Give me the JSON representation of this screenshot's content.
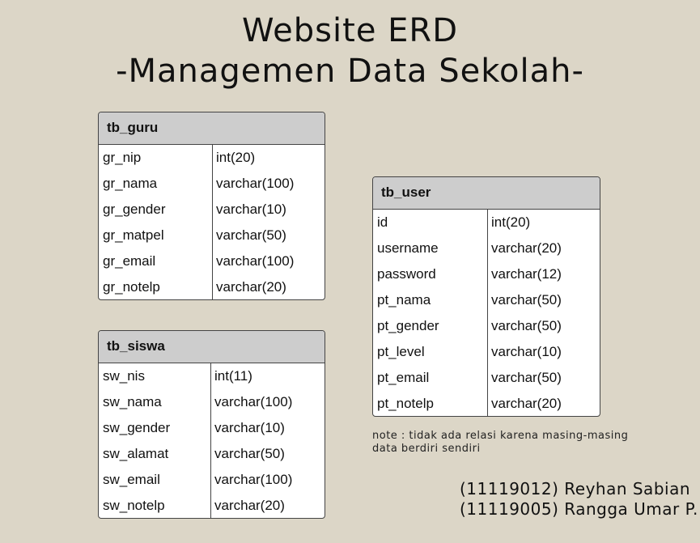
{
  "title": {
    "line1": "Website ERD",
    "line2": "-Managemen Data Sekolah-"
  },
  "entities": [
    {
      "name": "tb_guru",
      "fields": [
        {
          "name": "gr_nip",
          "type": "int(20)"
        },
        {
          "name": "gr_nama",
          "type": "varchar(100)"
        },
        {
          "name": "gr_gender",
          "type": "varchar(10)"
        },
        {
          "name": "gr_matpel",
          "type": "varchar(50)"
        },
        {
          "name": "gr_email",
          "type": "varchar(100)"
        },
        {
          "name": "gr_notelp",
          "type": "varchar(20)"
        }
      ]
    },
    {
      "name": "tb_siswa",
      "fields": [
        {
          "name": "sw_nis",
          "type": "int(11)"
        },
        {
          "name": "sw_nama",
          "type": "varchar(100)"
        },
        {
          "name": "sw_gender",
          "type": "varchar(10)"
        },
        {
          "name": "sw_alamat",
          "type": "varchar(50)"
        },
        {
          "name": "sw_email",
          "type": "varchar(100)"
        },
        {
          "name": "sw_notelp",
          "type": "varchar(20)"
        }
      ]
    },
    {
      "name": "tb_user",
      "fields": [
        {
          "name": "id",
          "type": "int(20)"
        },
        {
          "name": "username",
          "type": "varchar(20)"
        },
        {
          "name": "password",
          "type": "varchar(12)"
        },
        {
          "name": "pt_nama",
          "type": "varchar(50)"
        },
        {
          "name": "pt_gender",
          "type": "varchar(50)"
        },
        {
          "name": "pt_level",
          "type": "varchar(10)"
        },
        {
          "name": "pt_email",
          "type": "varchar(50)"
        },
        {
          "name": "pt_notelp",
          "type": "varchar(20)"
        }
      ]
    }
  ],
  "note": {
    "line1": "note : tidak ada relasi karena masing-masing",
    "line2": "data berdiri sendiri"
  },
  "authors": [
    "(11119012) Reyhan Sabian",
    "(11119005) Rangga Umar P."
  ]
}
